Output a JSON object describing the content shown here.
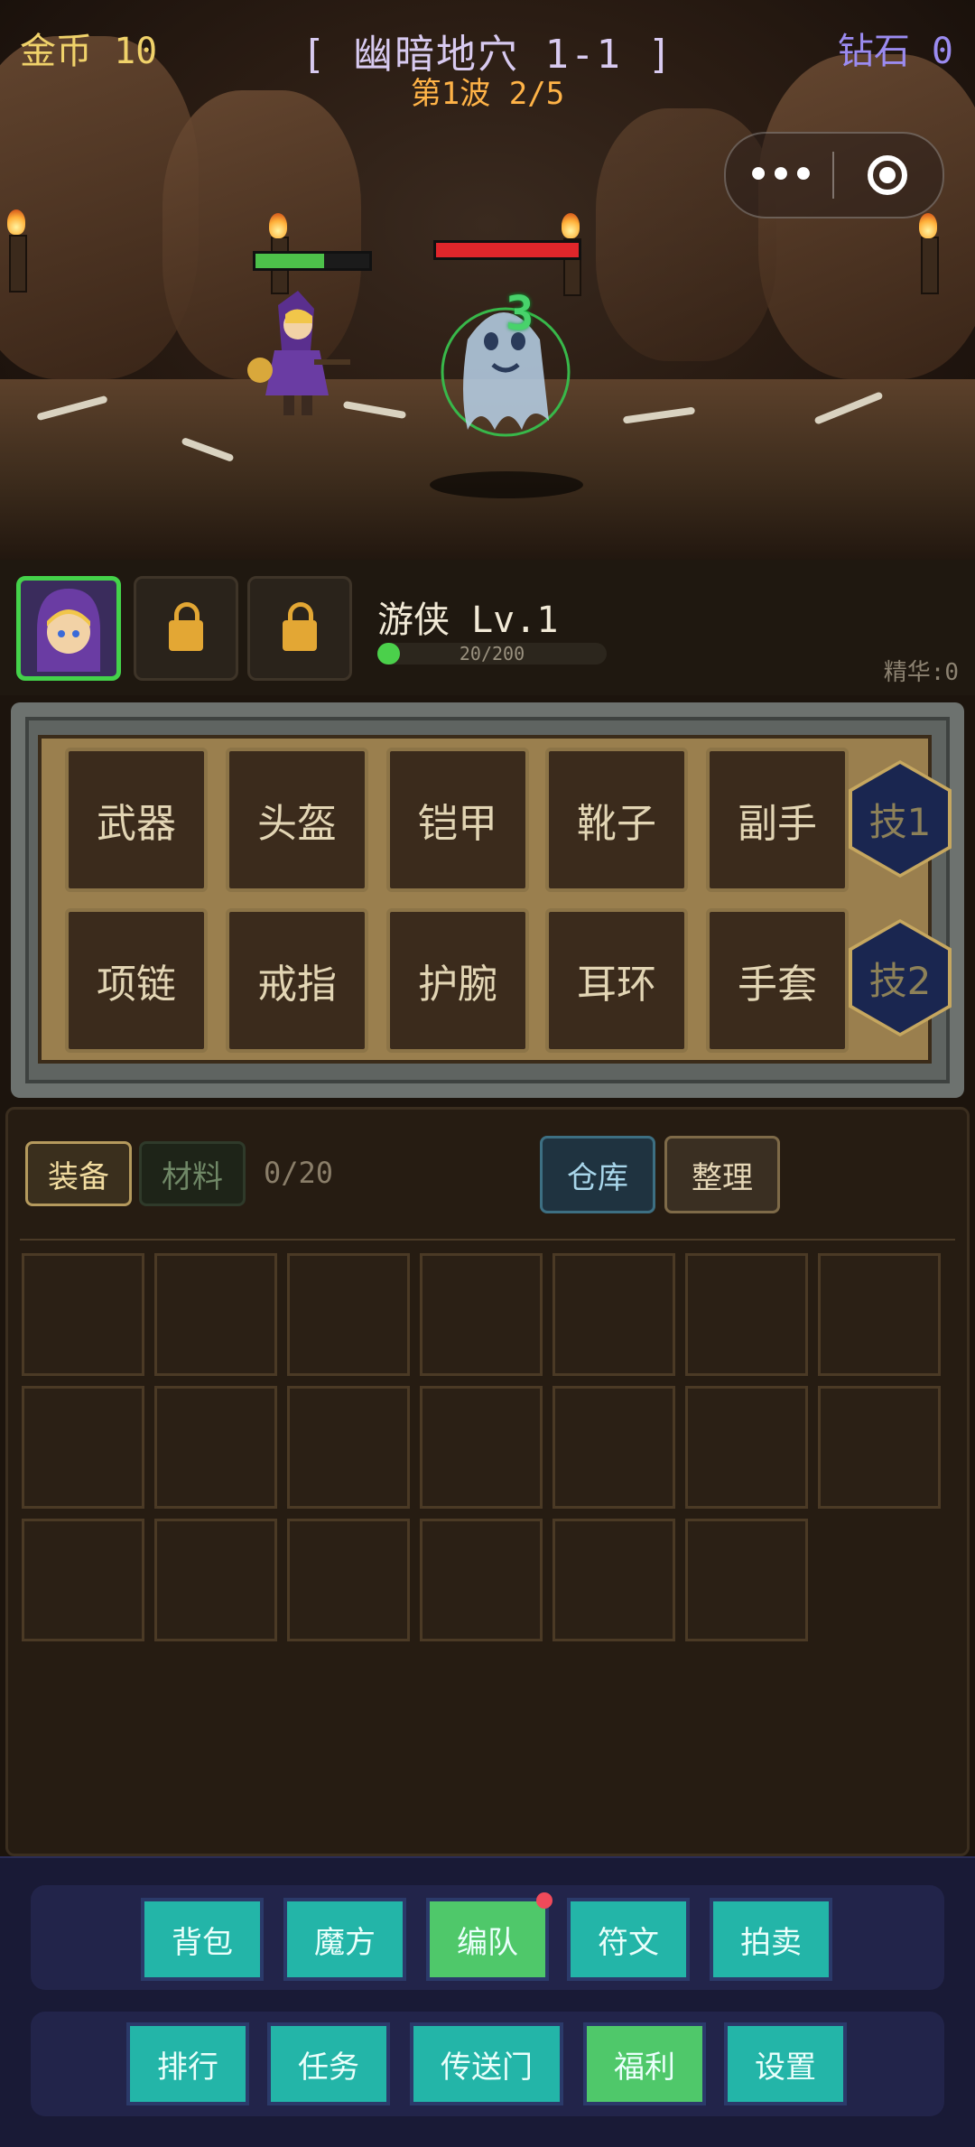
{
  "hud": {
    "gold": "金币 10",
    "stage_title": "[ 幽暗地穴 1-1 ]",
    "wave": "第1波 2/5",
    "diamonds": "钻石 0"
  },
  "battle": {
    "hero_hp": 0.6,
    "enemy_hp": 1.0,
    "damage_number": "3"
  },
  "party": {
    "hero_name": "游侠 Lv.1",
    "xp_text": "20/200",
    "xp_fraction": 0.1,
    "essence": "精华:0"
  },
  "equipment": {
    "row1": [
      "武器",
      "头盔",
      "铠甲",
      "靴子",
      "副手"
    ],
    "row2": [
      "项链",
      "戒指",
      "护腕",
      "耳环",
      "手套"
    ],
    "skill1": "技1",
    "skill2": "技2"
  },
  "inventory": {
    "tab_equip": "装备",
    "tab_material": "材料",
    "count": "0/20",
    "warehouse": "仓库",
    "sort": "整理"
  },
  "menu": {
    "row1": [
      "背包",
      "魔方",
      "编队",
      "符文",
      "拍卖"
    ],
    "row2": [
      "排行",
      "任务",
      "传送门",
      "福利",
      "设置"
    ]
  },
  "colors": {
    "gold": "#f0d26a",
    "diamond": "#9b8bf0",
    "teal_button": "#23b5a8",
    "green_button": "#4fc86a"
  }
}
